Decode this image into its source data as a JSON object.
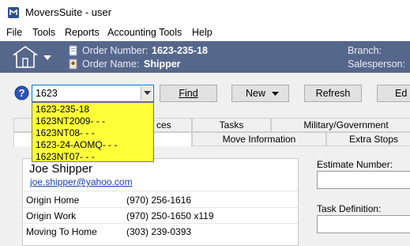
{
  "window": {
    "title": "MoversSuite - user"
  },
  "menu": {
    "items": [
      "File",
      "Tools",
      "Reports",
      "Accounting Tools",
      "Help"
    ]
  },
  "header": {
    "order_number_label": "Order Number:",
    "order_number_value": "1623-235-18",
    "order_name_label": "Order Name:",
    "order_name_value": "Shipper",
    "branch_label": "Branch:",
    "salesperson_label": "Salesperson:",
    "bg_color": "#56678c"
  },
  "search": {
    "value": "1623",
    "suggestions": [
      "1623-235-18",
      "1623NT2009- - -",
      "1623NT08- - -",
      "1623-24-AOMQ- - -",
      "1623NT07- - -"
    ],
    "dropdown_color": "#ffff3a"
  },
  "toolbar": {
    "find": "Find",
    "new": "New",
    "refresh": "Refresh",
    "edit_partial": "Ed"
  },
  "tabs": {
    "row1": [
      "ces",
      "Tasks",
      "Military/Government"
    ],
    "row2": [
      "Move Information",
      "Extra Stops"
    ]
  },
  "contact": {
    "name": "Joe Shipper",
    "email": "joe.shipper@yahoo.com",
    "phones": [
      {
        "label": "Origin Home",
        "value": "(970) 256-1616"
      },
      {
        "label": "Origin Work",
        "value": "(970) 250-1650 x119"
      },
      {
        "label": "Moving To Home",
        "value": "(303) 239-0393"
      }
    ]
  },
  "right_panel": {
    "estimate_label": "Estimate Number:",
    "task_def_label": "Task Definition:"
  }
}
